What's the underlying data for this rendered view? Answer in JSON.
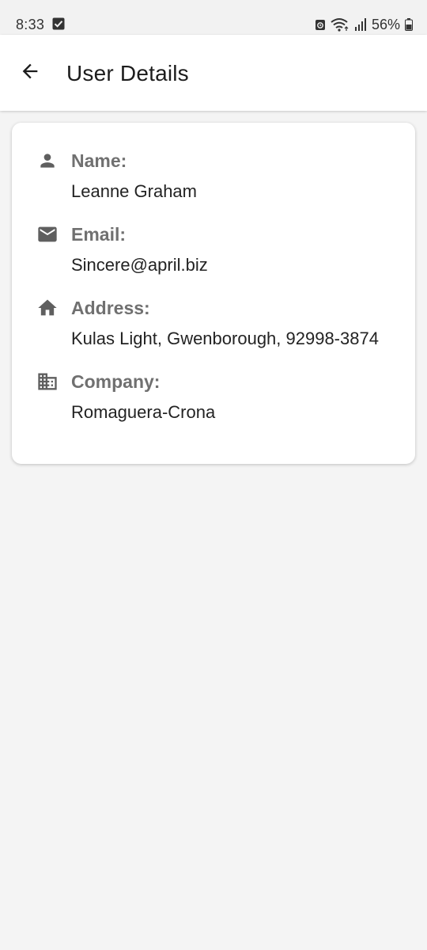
{
  "status_bar": {
    "time": "8:33",
    "battery": "56%"
  },
  "app_bar": {
    "title": "User Details"
  },
  "user": {
    "fields": [
      {
        "icon": "person-icon",
        "label": "Name:",
        "value": "Leanne Graham"
      },
      {
        "icon": "email-icon",
        "label": "Email:",
        "value": "Sincere@april.biz"
      },
      {
        "icon": "home-icon",
        "label": "Address:",
        "value": "Kulas Light, Gwenborough, 92998-3874"
      },
      {
        "icon": "business-icon",
        "label": "Company:",
        "value": "Romaguera-Crona"
      }
    ]
  }
}
